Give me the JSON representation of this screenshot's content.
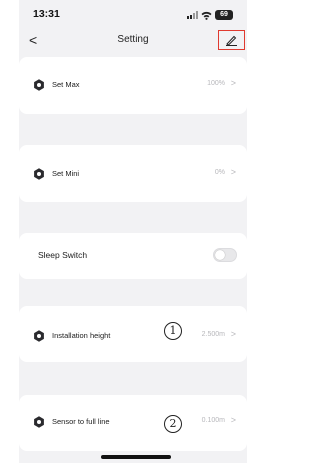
{
  "status_bar": {
    "time": "13:31",
    "battery": "69"
  },
  "nav": {
    "back_glyph": "<",
    "title": "Setting",
    "edit_icon": "pencil-icon",
    "edit_highlight_color": "#e03a2f"
  },
  "settings": [
    {
      "label": "Set Max",
      "value": "100%",
      "icon": "gear-icon"
    },
    {
      "label": "Set Mini",
      "value": "0%",
      "icon": "gear-icon"
    },
    {
      "label": "Sleep Switch",
      "toggle_on": false
    },
    {
      "label": "Installation height",
      "value": "2.500m",
      "icon": "gear-icon",
      "annotation": "1"
    },
    {
      "label": "Sensor to full line",
      "value": "0.100m",
      "icon": "gear-icon",
      "annotation": "2"
    }
  ],
  "chevron_glyph": ">"
}
